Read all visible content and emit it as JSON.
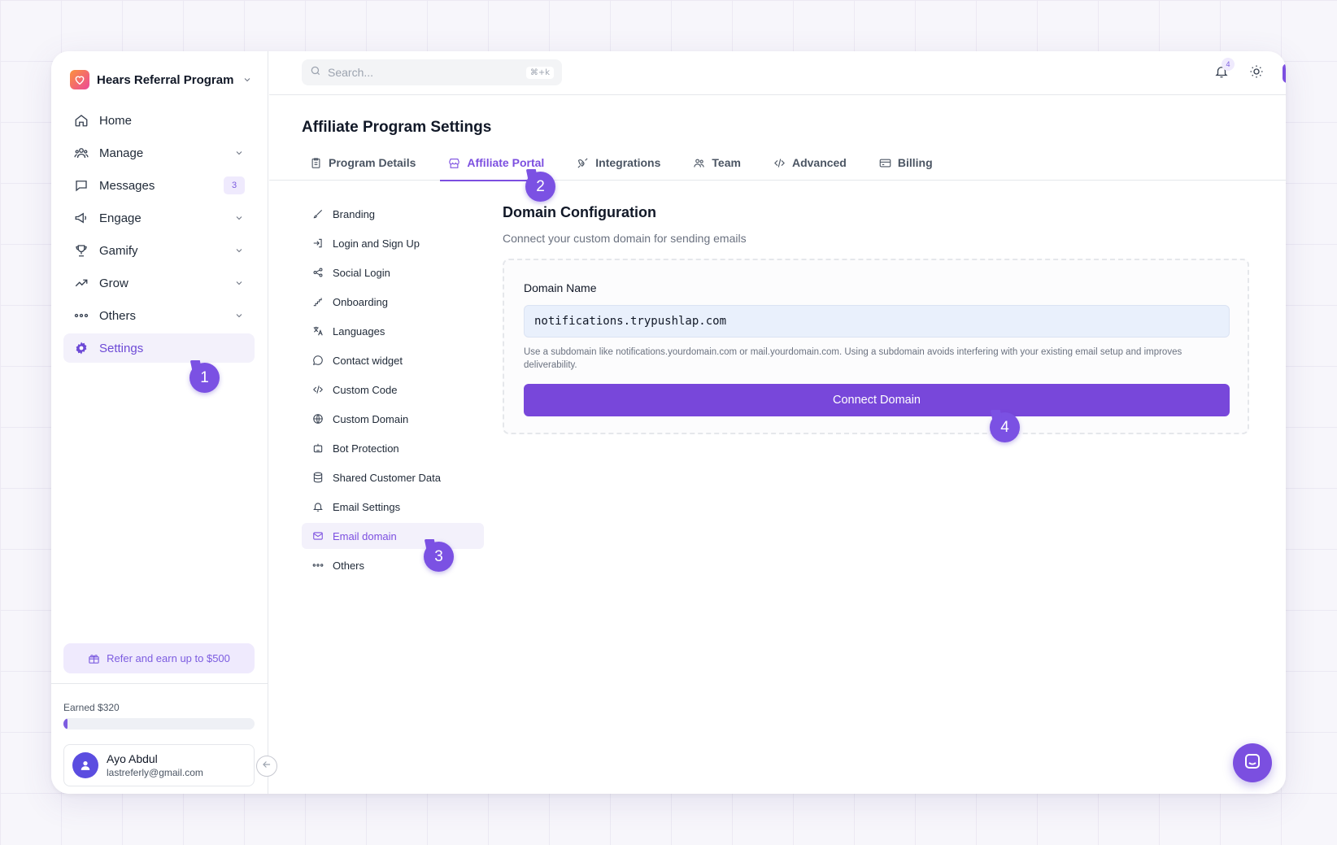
{
  "brand": {
    "name": "Hears Referral Program"
  },
  "nav": {
    "items": [
      {
        "label": "Home",
        "icon": "home-icon"
      },
      {
        "label": "Manage",
        "icon": "users-icon"
      },
      {
        "label": "Messages",
        "icon": "message-icon",
        "badge": "3"
      },
      {
        "label": "Engage",
        "icon": "megaphone-icon"
      },
      {
        "label": "Gamify",
        "icon": "trophy-icon"
      },
      {
        "label": "Grow",
        "icon": "trending-up-icon"
      },
      {
        "label": "Others",
        "icon": "dots-icon"
      },
      {
        "label": "Settings",
        "icon": "gear-icon",
        "active": true
      }
    ]
  },
  "refer": {
    "label": "Refer and earn up to $500"
  },
  "earnings": {
    "label": "Earned $320",
    "progress": 0.02
  },
  "user": {
    "name": "Ayo Abdul",
    "email": "lastreferly@gmail.com"
  },
  "search": {
    "placeholder": "Search...",
    "shortcut": "⌘+k"
  },
  "notifications": {
    "count": "4"
  },
  "page": {
    "title": "Affiliate Program Settings"
  },
  "tabs": [
    {
      "label": "Program Details",
      "icon": "clipboard-icon"
    },
    {
      "label": "Affiliate Portal",
      "icon": "store-icon",
      "active": true
    },
    {
      "label": "Integrations",
      "icon": "plug-icon"
    },
    {
      "label": "Team",
      "icon": "team-icon"
    },
    {
      "label": "Advanced",
      "icon": "code-icon"
    },
    {
      "label": "Billing",
      "icon": "credit-card-icon"
    }
  ],
  "subnav": [
    {
      "label": "Branding",
      "icon": "brush-icon"
    },
    {
      "label": "Login and Sign Up",
      "icon": "login-icon"
    },
    {
      "label": "Social Login",
      "icon": "share-icon"
    },
    {
      "label": "Onboarding",
      "icon": "stairs-icon"
    },
    {
      "label": "Languages",
      "icon": "translate-icon"
    },
    {
      "label": "Contact widget",
      "icon": "chat-bubble-icon"
    },
    {
      "label": "Custom Code",
      "icon": "code-icon"
    },
    {
      "label": "Custom Domain",
      "icon": "globe-icon"
    },
    {
      "label": "Bot Protection",
      "icon": "bot-icon"
    },
    {
      "label": "Shared Customer Data",
      "icon": "database-icon"
    },
    {
      "label": "Email Settings",
      "icon": "bell-icon"
    },
    {
      "label": "Email domain",
      "icon": "mail-icon",
      "active": true
    },
    {
      "label": "Others",
      "icon": "dots-icon"
    }
  ],
  "domain": {
    "title": "Domain Configuration",
    "subtitle": "Connect your custom domain for sending emails",
    "field_label": "Domain Name",
    "value": "notifications.trypushlap.com",
    "help": "Use a subdomain like notifications.yourdomain.com or mail.yourdomain.com. Using a subdomain avoids interfering with your existing email setup and improves deliverability.",
    "button": "Connect Domain"
  },
  "markers": [
    "1",
    "2",
    "3",
    "4"
  ],
  "colors": {
    "accent": "#7c4fe0",
    "accent_light": "#efeafd"
  }
}
